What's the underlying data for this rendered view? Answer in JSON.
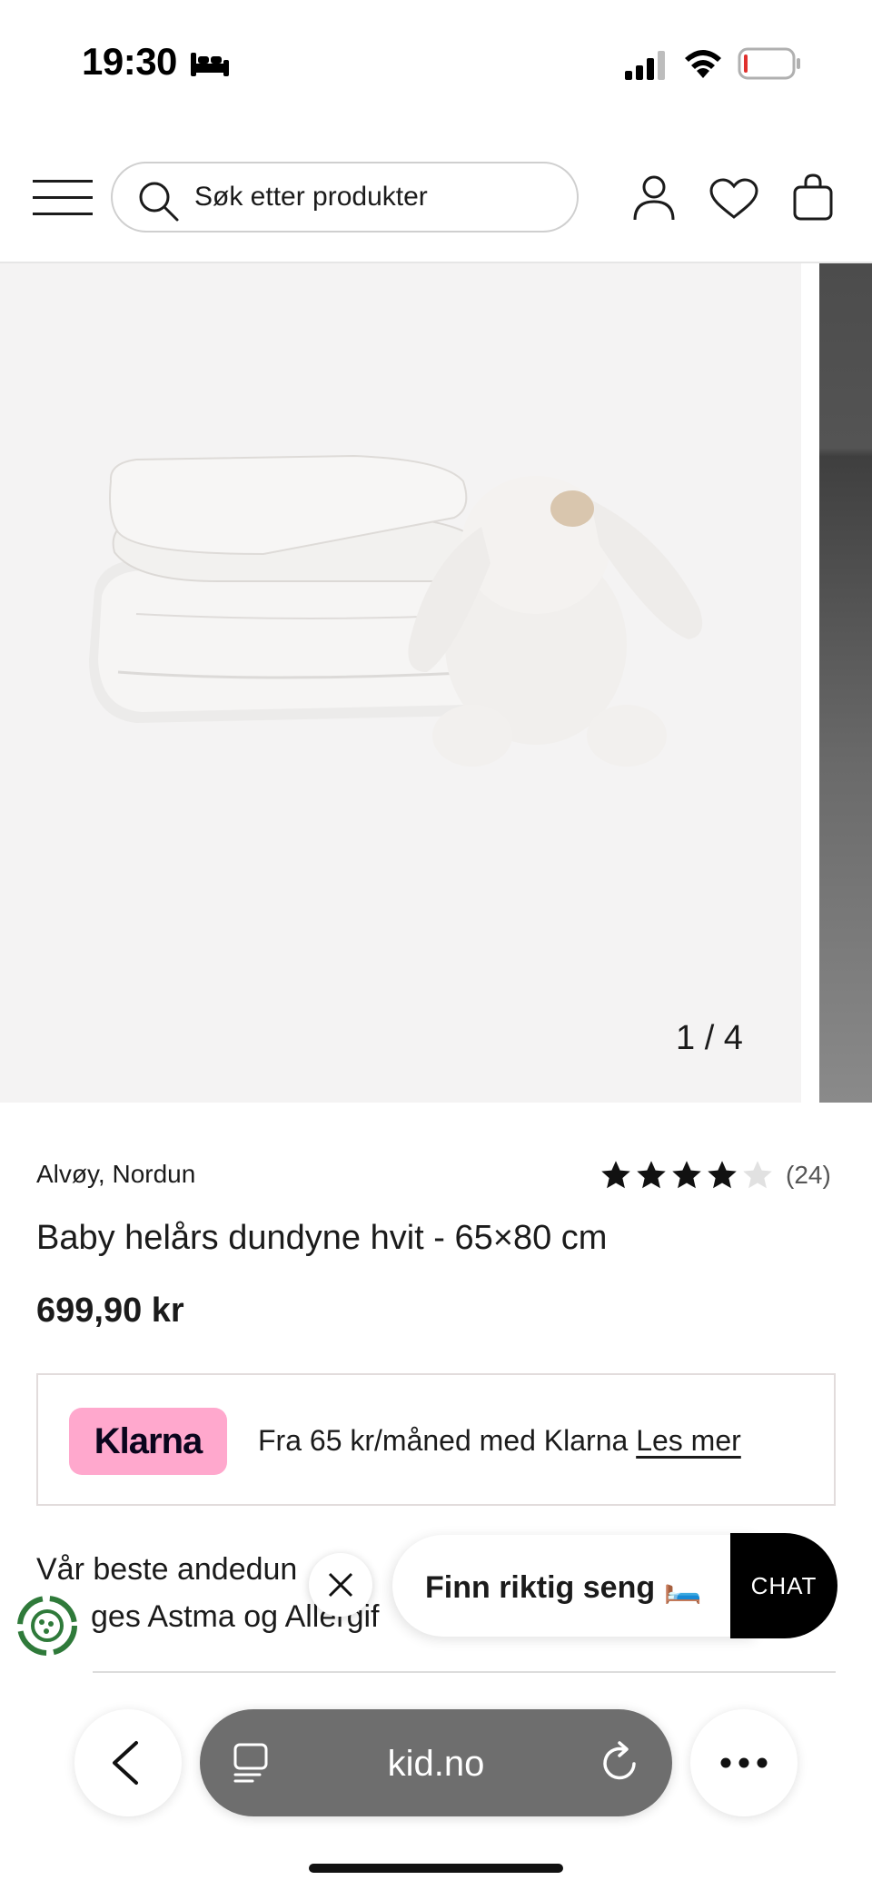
{
  "status_bar": {
    "time": "19:30",
    "icons": [
      "bed-icon",
      "signal-icon",
      "wifi-icon",
      "battery-icon"
    ]
  },
  "header": {
    "search_placeholder": "Søk etter produkter",
    "icons": [
      "menu-icon",
      "search-icon",
      "account-icon",
      "heart-icon",
      "bag-icon"
    ]
  },
  "gallery": {
    "counter": "1 / 4"
  },
  "product": {
    "brand": "Alvøy, Nordun",
    "rating": {
      "stars": 4,
      "max": 5,
      "count": "(24)"
    },
    "title": "Baby helårs dundyne hvit - 65×80 cm",
    "price": "699,90 kr"
  },
  "klarna": {
    "badge": "Klarna",
    "text": "Fra 65 kr/måned med Klarna",
    "link": "Les mer",
    "badge_color": "#ffa8cd"
  },
  "description": {
    "line1": "Vår beste andedun",
    "line2": "ges Astma og Allergif"
  },
  "floating": {
    "promo": "Finn riktig seng 🛏️",
    "chat": "CHAT"
  },
  "browser": {
    "url": "kid.no",
    "icons": [
      "back-icon",
      "tabs-icon",
      "reload-icon",
      "more-icon"
    ]
  }
}
